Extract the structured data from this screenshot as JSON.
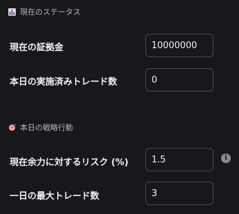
{
  "status_section": {
    "icon": "bar-chart-icon",
    "title": "現在のステータス",
    "fields": [
      {
        "label": "現在の証拠金",
        "value": "10000000"
      },
      {
        "label": "本日の実施済みトレード数",
        "value": "0"
      }
    ]
  },
  "strategy_section": {
    "icon": "target-icon",
    "title": "本日の戦略行動",
    "fields": [
      {
        "label": "現在余力に対するリスク (%)",
        "value": "1.5"
      },
      {
        "label": "一日の最大トレード数",
        "value": "3"
      }
    ],
    "info_icon": "info-icon"
  }
}
